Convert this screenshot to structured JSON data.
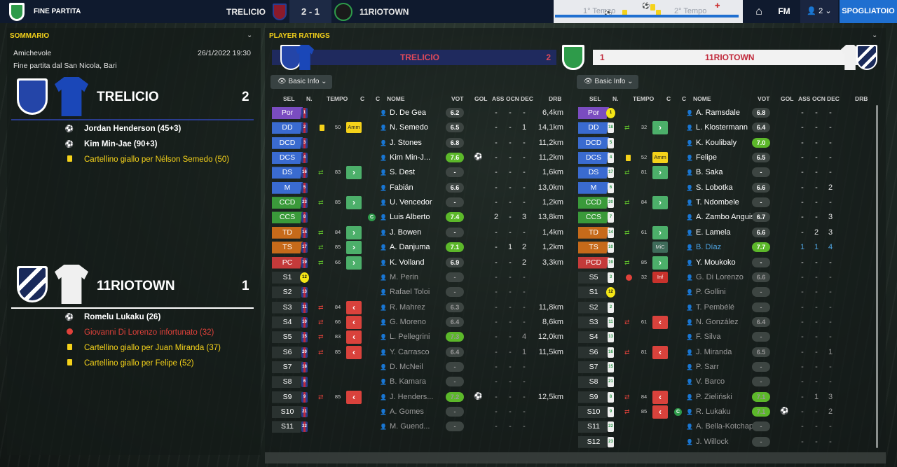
{
  "topbar": {
    "status": "Fine partita",
    "home_team": "TRELICIO",
    "score": "2 - 1",
    "away_team": "11RIOTOWN",
    "first_half": "1° Tempo",
    "second_half": "2° Tempo",
    "menu_fm": "FM",
    "people_count": "2",
    "dressing_room": "SPOGLIATOIO"
  },
  "summary": {
    "title": "SOMMARIO",
    "competition": "Amichevole",
    "datetime": "26/1/2022 19:30",
    "venue": "Fine partita dal San Nicola, Bari",
    "home": {
      "name": "TRELICIO",
      "goals": "2",
      "events": [
        {
          "type": "goal",
          "text": "Jordan Henderson (45+3)"
        },
        {
          "type": "goal",
          "text": "Kim Min-Jae (90+3)"
        },
        {
          "type": "yellow",
          "text": "Cartellino giallo per Nélson Semedo (50)"
        }
      ]
    },
    "away": {
      "name": "11RIOTOWN",
      "goals": "1",
      "events": [
        {
          "type": "goal",
          "text": "Romelu Lukaku (26)"
        },
        {
          "type": "injury",
          "text": "Giovanni Di Lorenzo infortunato (32)"
        },
        {
          "type": "yellow",
          "text": "Cartellino giallo per Juan Miranda (37)"
        },
        {
          "type": "yellow",
          "text": "Cartellino giallo per Felipe (52)"
        }
      ]
    }
  },
  "ratings": {
    "title": "PLAYER RATINGS",
    "filter_label": "Basic Info",
    "home_banner": {
      "name": "TRELICIO",
      "goals": "2"
    },
    "away_banner": {
      "name": "11RIOTOWN",
      "goals": "1"
    },
    "headers": {
      "sel": "SEL",
      "n": "N.",
      "tempo": "TEMPO",
      "c": "C",
      "c2": "C",
      "nome": "NOME",
      "vot": "VOT",
      "gol": "GOL",
      "ass": "ASS",
      "ocn": "OCN",
      "dec": "DEC",
      "drb": "DRB"
    },
    "home_players": [
      {
        "pos": "Por",
        "num": "1",
        "name": "D. De Gea",
        "vot": "6.2",
        "ass": "-",
        "ocn": "-",
        "dec": "-",
        "drb": "6,4km",
        "posc": "#7a4cc0"
      },
      {
        "pos": "DD",
        "num": "2",
        "name": "N. Semedo",
        "vot": "6.5",
        "ass": "-",
        "ocn": "-",
        "dec": "1",
        "drb": "14,1km",
        "posc": "#3a6bd0",
        "card": "yellow",
        "min": "50",
        "tag": "Amm"
      },
      {
        "pos": "DCD",
        "num": "3",
        "name": "J. Stones",
        "vot": "6.8",
        "ass": "-",
        "ocn": "-",
        "dec": "-",
        "drb": "11,2km",
        "posc": "#3a6bd0"
      },
      {
        "pos": "DCS",
        "num": "4",
        "name": "Kim Min-J...",
        "vot": "7.6",
        "good": true,
        "gol": "goal",
        "ass": "-",
        "ocn": "-",
        "dec": "-",
        "drb": "11,2km",
        "posc": "#3a6bd0"
      },
      {
        "pos": "DS",
        "num": "16",
        "name": "S. Dest",
        "vot": "-",
        "ass": "-",
        "ocn": "-",
        "dec": "-",
        "drb": "1,6km",
        "posc": "#3a6bd0",
        "arrow": "in",
        "min": "83",
        "sub": "in"
      },
      {
        "pos": "M",
        "num": "5",
        "name": "Fabián",
        "vot": "6.6",
        "ass": "-",
        "ocn": "-",
        "dec": "-",
        "drb": "13,0km",
        "posc": "#3a6bd0"
      },
      {
        "pos": "CCD",
        "num": "23",
        "name": "U. Vencedor",
        "vot": "-",
        "ass": "-",
        "ocn": "-",
        "dec": "-",
        "drb": "1,2km",
        "posc": "#3a9a3a",
        "arrow": "in",
        "min": "85",
        "sub": "in"
      },
      {
        "pos": "CCS",
        "num": "8",
        "name": "Luis Alberto",
        "vot": "7.4",
        "good": true,
        "cap": true,
        "ass": "2",
        "ocn": "-",
        "dec": "3",
        "drb": "13,8km",
        "posc": "#3a9a3a"
      },
      {
        "pos": "TD",
        "num": "14",
        "name": "J. Bowen",
        "vot": "-",
        "ass": "-",
        "ocn": "-",
        "dec": "-",
        "drb": "1,4km",
        "posc": "#c66a1a",
        "arrow": "in",
        "min": "84",
        "sub": "in"
      },
      {
        "pos": "TS",
        "num": "17",
        "name": "A. Danjuma",
        "vot": "7.1",
        "good": true,
        "ass": "-",
        "ocn": "1",
        "dec": "2",
        "drb": "1,2km",
        "posc": "#c66a1a",
        "arrow": "in",
        "min": "85",
        "sub": "in"
      },
      {
        "pos": "PC",
        "num": "19",
        "name": "K. Volland",
        "vot": "6.9",
        "ass": "-",
        "ocn": "-",
        "dec": "2",
        "drb": "3,3km",
        "posc": "#c43a3a",
        "arrow": "in",
        "min": "66",
        "sub": "in"
      },
      {
        "pos": "S1",
        "num": "12",
        "name": "M. Perin",
        "vot": "-",
        "ass": "-",
        "ocn": "-",
        "dec": "-",
        "drb": "",
        "posc": "#2a3230",
        "dim": true,
        "gk": true
      },
      {
        "pos": "S2",
        "num": "13",
        "name": "Rafael Toloi",
        "vot": "-",
        "ass": "-",
        "ocn": "-",
        "dec": "-",
        "drb": "",
        "posc": "#2a3230",
        "dim": true
      },
      {
        "pos": "S3",
        "num": "11",
        "name": "R. Mahrez",
        "vot": "6.3",
        "ass": "-",
        "ocn": "-",
        "dec": "-",
        "drb": "11,8km",
        "posc": "#2a3230",
        "dim": true,
        "arrow": "out",
        "min": "84",
        "sub": "out"
      },
      {
        "pos": "S4",
        "num": "10",
        "name": "G. Moreno",
        "vot": "6.4",
        "ass": "-",
        "ocn": "-",
        "dec": "-",
        "drb": "8,6km",
        "posc": "#2a3230",
        "dim": true,
        "arrow": "out",
        "min": "66",
        "sub": "out"
      },
      {
        "pos": "S5",
        "num": "15",
        "name": "L. Pellegrini",
        "vot": "7.3",
        "good": true,
        "ass": "-",
        "ocn": "-",
        "dec": "4",
        "drb": "12,0km",
        "posc": "#2a3230",
        "dim": true,
        "arrow": "out",
        "min": "83",
        "sub": "out"
      },
      {
        "pos": "S6",
        "num": "20",
        "name": "Y. Carrasco",
        "vot": "6.4",
        "ass": "-",
        "ocn": "-",
        "dec": "1",
        "drb": "11,5km",
        "posc": "#2a3230",
        "dim": true,
        "arrow": "out",
        "min": "85",
        "sub": "out"
      },
      {
        "pos": "S7",
        "num": "18",
        "name": "D. McNeil",
        "vot": "-",
        "ass": "-",
        "ocn": "-",
        "dec": "-",
        "drb": "",
        "posc": "#2a3230",
        "dim": true
      },
      {
        "pos": "S8",
        "num": "6",
        "name": "B. Kamara",
        "vot": "-",
        "ass": "-",
        "ocn": "-",
        "dec": "-",
        "drb": "",
        "posc": "#2a3230",
        "dim": true
      },
      {
        "pos": "S9",
        "num": "9",
        "name": "J. Henders...",
        "vot": "7.2",
        "good": true,
        "gol": "goal",
        "ass": "-",
        "ocn": "-",
        "dec": "-",
        "drb": "12,5km",
        "posc": "#2a3230",
        "dim": true,
        "arrow": "out",
        "min": "85",
        "sub": "out"
      },
      {
        "pos": "S10",
        "num": "21",
        "name": "A. Gomes",
        "vot": "-",
        "ass": "-",
        "ocn": "-",
        "dec": "-",
        "drb": "",
        "posc": "#2a3230",
        "dim": true
      },
      {
        "pos": "S11",
        "num": "22",
        "name": "M. Guend...",
        "vot": "-",
        "ass": "-",
        "ocn": "-",
        "dec": "-",
        "drb": "",
        "posc": "#2a3230",
        "dim": true
      }
    ],
    "away_players": [
      {
        "pos": "Por",
        "num": "1",
        "name": "A. Ramsdale",
        "vot": "6.8",
        "ass": "-",
        "ocn": "-",
        "dec": "-",
        "posc": "#7a4cc0",
        "gk": true
      },
      {
        "pos": "DD",
        "num": "18",
        "name": "L. Klostermann",
        "vot": "6.4",
        "ass": "-",
        "ocn": "-",
        "dec": "-",
        "posc": "#3a6bd0",
        "arrow": "in",
        "min": "32",
        "sub": "in"
      },
      {
        "pos": "DCD",
        "num": "5",
        "name": "K. Koulibaly",
        "vot": "7.0",
        "good": true,
        "ass": "-",
        "ocn": "-",
        "dec": "-",
        "posc": "#3a6bd0"
      },
      {
        "pos": "DCS",
        "num": "4",
        "name": "Felipe",
        "vot": "6.5",
        "ass": "-",
        "ocn": "-",
        "dec": "-",
        "posc": "#3a6bd0",
        "card": "yellow",
        "min": "52",
        "tag": "Amm"
      },
      {
        "pos": "DS",
        "num": "17",
        "name": "B. Saka",
        "vot": "-",
        "ass": "-",
        "ocn": "-",
        "dec": "-",
        "posc": "#3a6bd0",
        "arrow": "in",
        "min": "81",
        "sub": "in"
      },
      {
        "pos": "M",
        "num": "6",
        "name": "S. Lobotka",
        "vot": "6.6",
        "ass": "-",
        "ocn": "-",
        "dec": "2",
        "posc": "#3a6bd0"
      },
      {
        "pos": "CCD",
        "num": "20",
        "name": "T. Ndombele",
        "vot": "-",
        "ass": "-",
        "ocn": "-",
        "dec": "-",
        "posc": "#3a9a3a",
        "arrow": "in",
        "min": "84",
        "sub": "in"
      },
      {
        "pos": "CCS",
        "num": "7",
        "name": "A. Zambo Anguissa",
        "vot": "6.7",
        "ass": "-",
        "ocn": "-",
        "dec": "3",
        "posc": "#3a9a3a"
      },
      {
        "pos": "TD",
        "num": "14",
        "name": "E. Lamela",
        "vot": "6.6",
        "ass": "-",
        "ocn": "2",
        "dec": "3",
        "posc": "#c66a1a",
        "arrow": "in",
        "min": "61",
        "sub": "in"
      },
      {
        "pos": "TS",
        "num": "10",
        "name": "B. Díaz",
        "vot": "7.7",
        "good": true,
        "ass": "1",
        "ocn": "1",
        "dec": "4",
        "posc": "#c66a1a",
        "tag": "MiC",
        "hl": true
      },
      {
        "pos": "PCD",
        "num": "19",
        "name": "Y. Moukoko",
        "vot": "-",
        "ass": "-",
        "ocn": "-",
        "dec": "-",
        "posc": "#c43a3a",
        "arrow": "in",
        "min": "85",
        "sub": "in"
      },
      {
        "pos": "S5",
        "num": "3",
        "name": "G. Di Lorenzo",
        "vot": "6.6",
        "ass": "-",
        "ocn": "-",
        "dec": "-",
        "posc": "#2a3230",
        "dim": true,
        "inj": true,
        "min": "32",
        "tag": "Inf"
      },
      {
        "pos": "S1",
        "num": "12",
        "name": "P. Gollini",
        "vot": "-",
        "ass": "-",
        "ocn": "-",
        "dec": "-",
        "posc": "#2a3230",
        "dim": true,
        "gk": true
      },
      {
        "pos": "S2",
        "num": "2",
        "name": "T. Pembélé",
        "vot": "-",
        "ass": "-",
        "ocn": "-",
        "dec": "-",
        "posc": "#2a3230",
        "dim": true
      },
      {
        "pos": "S3",
        "num": "11",
        "name": "N. González",
        "vot": "6.4",
        "ass": "-",
        "ocn": "-",
        "dec": "-",
        "posc": "#2a3230",
        "dim": true,
        "arrow": "out",
        "min": "61",
        "sub": "out"
      },
      {
        "pos": "S4",
        "num": "13",
        "name": "F. Silva",
        "vot": "-",
        "ass": "-",
        "ocn": "-",
        "dec": "-",
        "posc": "#2a3230",
        "dim": true
      },
      {
        "pos": "S6",
        "num": "16",
        "name": "J. Miranda",
        "vot": "6.5",
        "ass": "-",
        "ocn": "-",
        "dec": "1",
        "posc": "#2a3230",
        "dim": true,
        "arrow": "out",
        "min": "81",
        "sub": "out"
      },
      {
        "pos": "S7",
        "num": "15",
        "name": "P. Sarr",
        "vot": "-",
        "ass": "-",
        "ocn": "-",
        "dec": "-",
        "posc": "#2a3230",
        "dim": true
      },
      {
        "pos": "S8",
        "num": "21",
        "name": "V. Barco",
        "vot": "-",
        "ass": "-",
        "ocn": "-",
        "dec": "-",
        "posc": "#2a3230",
        "dim": true
      },
      {
        "pos": "S9",
        "num": "8",
        "name": "P. Zieliński",
        "vot": "7.1",
        "good": true,
        "ass": "-",
        "ocn": "1",
        "dec": "3",
        "posc": "#2a3230",
        "dim": true,
        "arrow": "out",
        "min": "84",
        "sub": "out"
      },
      {
        "pos": "S10",
        "num": "9",
        "name": "R. Lukaku",
        "vot": "7.1",
        "good": true,
        "cap": true,
        "gol": "goal",
        "ass": "-",
        "ocn": "-",
        "dec": "2",
        "posc": "#2a3230",
        "dim": true,
        "arrow": "out",
        "min": "85",
        "sub": "out"
      },
      {
        "pos": "S11",
        "num": "22",
        "name": "A. Bella-Kotchap",
        "vot": "-",
        "ass": "-",
        "ocn": "-",
        "dec": "-",
        "posc": "#2a3230",
        "dim": true
      },
      {
        "pos": "S12",
        "num": "23",
        "name": "J. Willock",
        "vot": "-",
        "ass": "-",
        "ocn": "-",
        "dec": "-",
        "posc": "#2a3230",
        "dim": true
      }
    ]
  },
  "colors": {
    "accent": "#f5d21a",
    "home": "#2a3c8e",
    "away": "#ffffff",
    "blue": "#1f6fd0",
    "good": "#5cb82a"
  },
  "icons": {
    "home": "home-icon",
    "people": "people-icon",
    "goal": "football-icon",
    "yellow": "yellow-card-icon",
    "injury": "injury-icon",
    "sub_in": "sub-in-arrow-icon",
    "sub_out": "sub-out-arrow-icon"
  }
}
